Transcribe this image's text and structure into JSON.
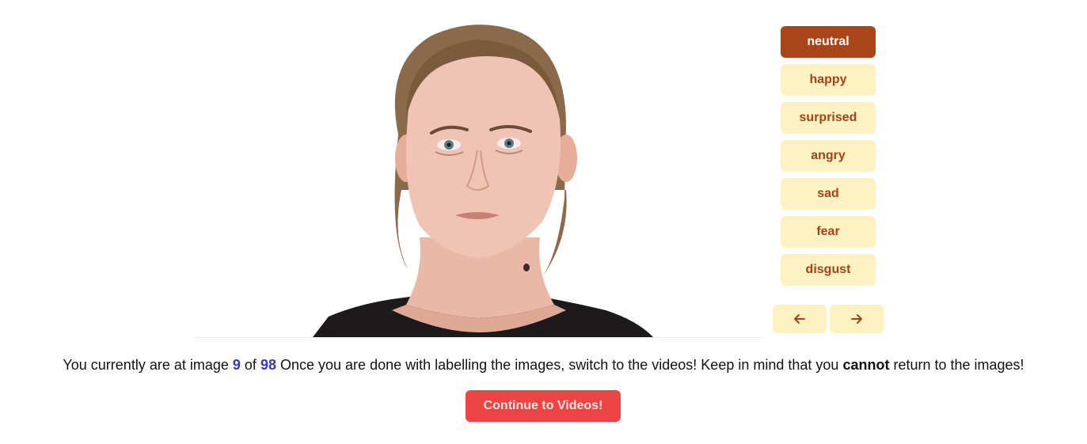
{
  "labels": {
    "items": [
      {
        "label": "neutral",
        "selected": true
      },
      {
        "label": "happy",
        "selected": false
      },
      {
        "label": "surprised",
        "selected": false
      },
      {
        "label": "angry",
        "selected": false
      },
      {
        "label": "sad",
        "selected": false
      },
      {
        "label": "fear",
        "selected": false
      },
      {
        "label": "disgust",
        "selected": false
      }
    ]
  },
  "nav": {
    "prev_icon": "arrow-left-icon",
    "next_icon": "arrow-right-icon"
  },
  "status": {
    "prefix": "You currently are at image",
    "current": "9",
    "of": "of",
    "total": "98",
    "middle": "Once you are done with labelling the images, switch to the videos! Keep in mind that you",
    "emphasis": "cannot",
    "suffix": "return to the images!"
  },
  "continue_button": {
    "label": "Continue to Videos!"
  },
  "colors": {
    "label_bg": "#fef1c2",
    "label_text": "#a3431a",
    "label_selected_bg": "#a8461a",
    "count_color": "#3b36c4",
    "continue_bg": "#ef4444"
  }
}
